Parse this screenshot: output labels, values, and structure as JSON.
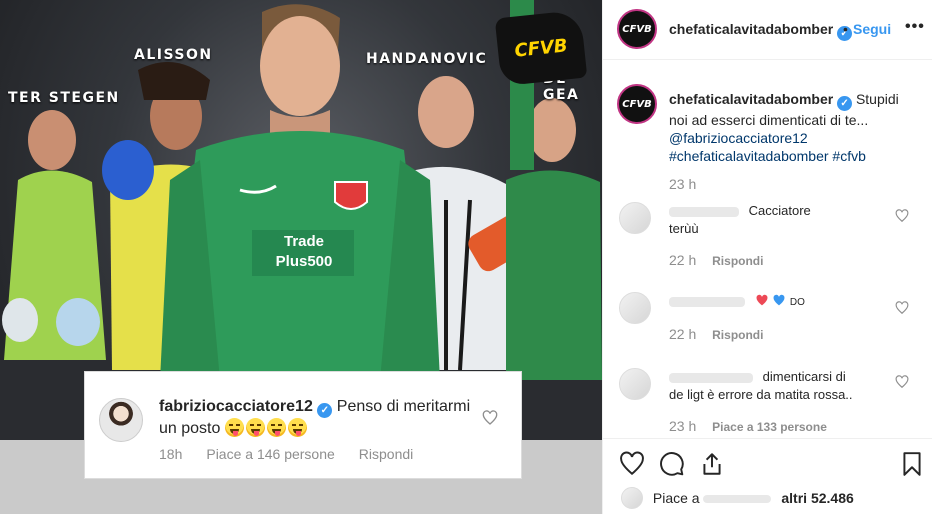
{
  "image": {
    "player_names": [
      "TER STEGEN",
      "ALISSON",
      "HANDANOVIC",
      "DE GEA"
    ],
    "brand_badge": "CFVB",
    "jersey_text": [
      "Trade",
      "Plus500"
    ],
    "comment_card": {
      "username": "fabriziocacciatore12",
      "text": "Penso di meritarmi un posto",
      "time": "18h",
      "likes": "Piace a 146 persone",
      "reply": "Rispondi"
    }
  },
  "header": {
    "avatar_text": "CFVB",
    "username": "chefaticalavitadabomber",
    "dot": "•",
    "follow": "Segui",
    "more": "•••"
  },
  "caption": {
    "avatar_text": "CFVB",
    "username": "chefaticalavitadabomber",
    "text": "Stupidi noi ad esserci dimenticati di te...",
    "mention": "@fabriziocacciatore12",
    "hashtags": "#chefaticalavitadabomber #cfvb",
    "time": "23 h"
  },
  "comments": [
    {
      "text_a": "Cacciatore",
      "text_b": "terùù",
      "time": "22 h",
      "reply": "Rispondi"
    },
    {
      "text_a": "DO",
      "time": "22 h",
      "reply": "Rispondi"
    },
    {
      "text_a": "dimenticarsi di",
      "text_b": "de ligt è errore da matita rossa..",
      "time": "23 h",
      "likes": "Piace a 133 persone"
    }
  ],
  "footer": {
    "likes_prefix": "Piace a",
    "likes_suffix": "altri 52.486"
  },
  "colors": {
    "link_blue": "#3897f0",
    "hashtag_blue": "#00376b",
    "muted": "#8e8e8e",
    "heart_red": "#ed4956",
    "heart_blue": "#3897f0"
  }
}
